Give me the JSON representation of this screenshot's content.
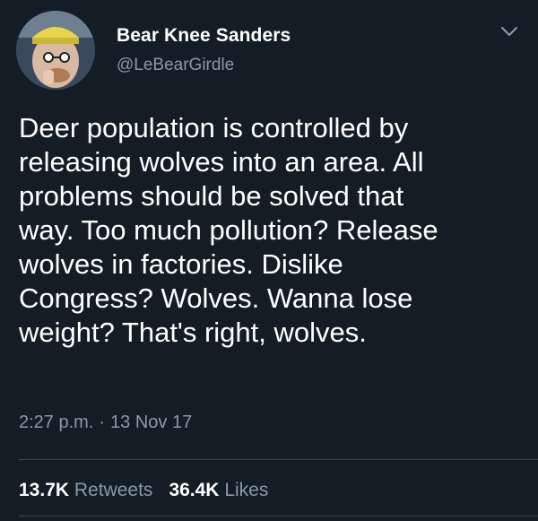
{
  "author": {
    "display_name": "Bear Knee Sanders",
    "handle": "@LeBearGirdle"
  },
  "tweet": {
    "text": "Deer population is controlled by\nreleasing wolves into an area. All\nproblems should be solved that\nway. Too much pollution? Release\nwolves in factories. Dislike\nCongress? Wolves. Wanna lose\nweight? That's right, wolves.",
    "time": "2:27 p.m.",
    "separator": "·",
    "date": "13 Nov 17"
  },
  "stats": {
    "retweets_count": "13.7K",
    "retweets_label": "Retweets",
    "likes_count": "36.4K",
    "likes_label": "Likes"
  },
  "icons": {
    "menu": "chevron-down-icon"
  },
  "colors": {
    "background": "#141d26",
    "text_primary": "#ffffff",
    "text_secondary": "#8899a6",
    "divider": "#38444d"
  }
}
